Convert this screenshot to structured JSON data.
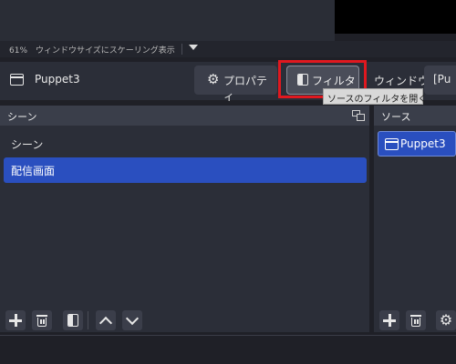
{
  "preview": {
    "zoom_text": "61%　ウィンドウサイズにスケーリング表示"
  },
  "source_toolbar": {
    "source_name": "Puppet3",
    "properties_label": "プロパティ",
    "filters_label": "フィルタ",
    "window_label": "ウィンドウ",
    "window_value": "[Pu"
  },
  "tooltip": {
    "text": "ソースのフィルタを開く"
  },
  "scenes": {
    "title": "シーン",
    "items": [
      {
        "label": "シーン"
      },
      {
        "label": "配信画面"
      }
    ],
    "selected_index": 1
  },
  "sources": {
    "title": "ソース",
    "items": [
      {
        "label": "Puppet3"
      }
    ]
  },
  "colors": {
    "background": "#1f2027",
    "panel": "#2b2e38",
    "header": "#3a3e4a",
    "selection": "#2a4fbf",
    "highlight_box": "#e0181f"
  }
}
